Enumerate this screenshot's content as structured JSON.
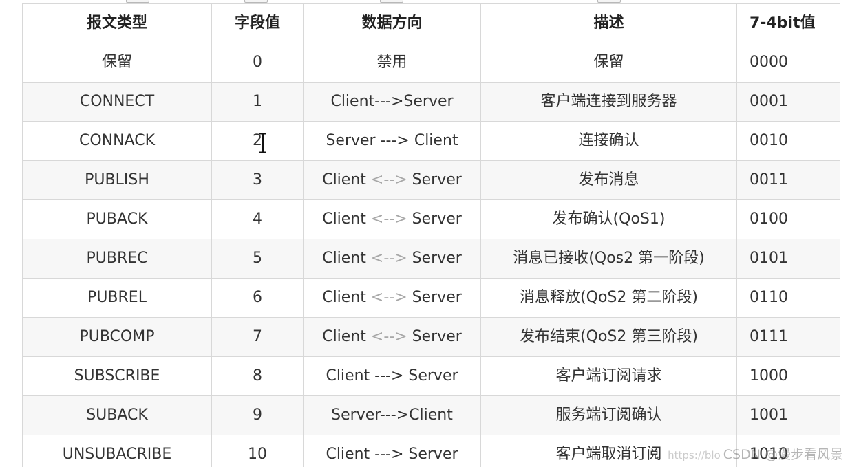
{
  "table": {
    "headers": [
      "报文类型",
      "字段值",
      "数据方向",
      "描述",
      "7-4bit值"
    ],
    "rows": [
      {
        "type": "保留",
        "value": "0",
        "direction": "禁用",
        "direction_parts": null,
        "desc": "保留",
        "bits": "0000"
      },
      {
        "type": "CONNECT",
        "value": "1",
        "direction": "Client--->Server",
        "direction_parts": null,
        "desc": "客户端连接到服务器",
        "bits": "0001"
      },
      {
        "type": "CONNACK",
        "value": "2",
        "direction": "Server ---> Client",
        "direction_parts": null,
        "desc": "连接确认",
        "bits": "0010"
      },
      {
        "type": "PUBLISH",
        "value": "3",
        "direction": "Client <--> Server",
        "direction_parts": [
          "Client ",
          "<-->",
          " Server"
        ],
        "desc": "发布消息",
        "bits": "0011"
      },
      {
        "type": "PUBACK",
        "value": "4",
        "direction": "Client <--> Server",
        "direction_parts": [
          "Client ",
          "<-->",
          " Server"
        ],
        "desc": "发布确认(QoS1)",
        "bits": "0100"
      },
      {
        "type": "PUBREC",
        "value": "5",
        "direction": "Client <--> Server",
        "direction_parts": [
          "Client ",
          "<-->",
          " Server"
        ],
        "desc": "消息已接收(Qos2 第一阶段)",
        "bits": "0101"
      },
      {
        "type": "PUBREL",
        "value": "6",
        "direction": "Client <--> Server",
        "direction_parts": [
          "Client ",
          "<-->",
          " Server"
        ],
        "desc": "消息释放(QoS2 第二阶段)",
        "bits": "0110"
      },
      {
        "type": "PUBCOMP",
        "value": "7",
        "direction": "Client <--> Server",
        "direction_parts": [
          "Client ",
          "<-->",
          " Server"
        ],
        "desc": "发布结束(QoS2 第三阶段)",
        "bits": "0111"
      },
      {
        "type": "SUBSCRIBE",
        "value": "8",
        "direction": "Client ---> Server",
        "direction_parts": null,
        "desc": "客户端订阅请求",
        "bits": "1000"
      },
      {
        "type": "SUBACK",
        "value": "9",
        "direction": "Server--->Client",
        "direction_parts": null,
        "desc": "服务端订阅确认",
        "bits": "1001"
      },
      {
        "type": "UNSUBACRIBE",
        "value": "10",
        "direction": "Client ---> Server",
        "direction_parts": null,
        "desc": "客户端取消订阅",
        "bits": "1010"
      }
    ]
  },
  "watermark": {
    "url": "https://blo",
    "text": "CSDN @漫步看风景"
  },
  "colors": {
    "border": "#d8d8d8",
    "shaded_row": "#f7f7f7",
    "faint_arrow": "#a8a8a8"
  }
}
